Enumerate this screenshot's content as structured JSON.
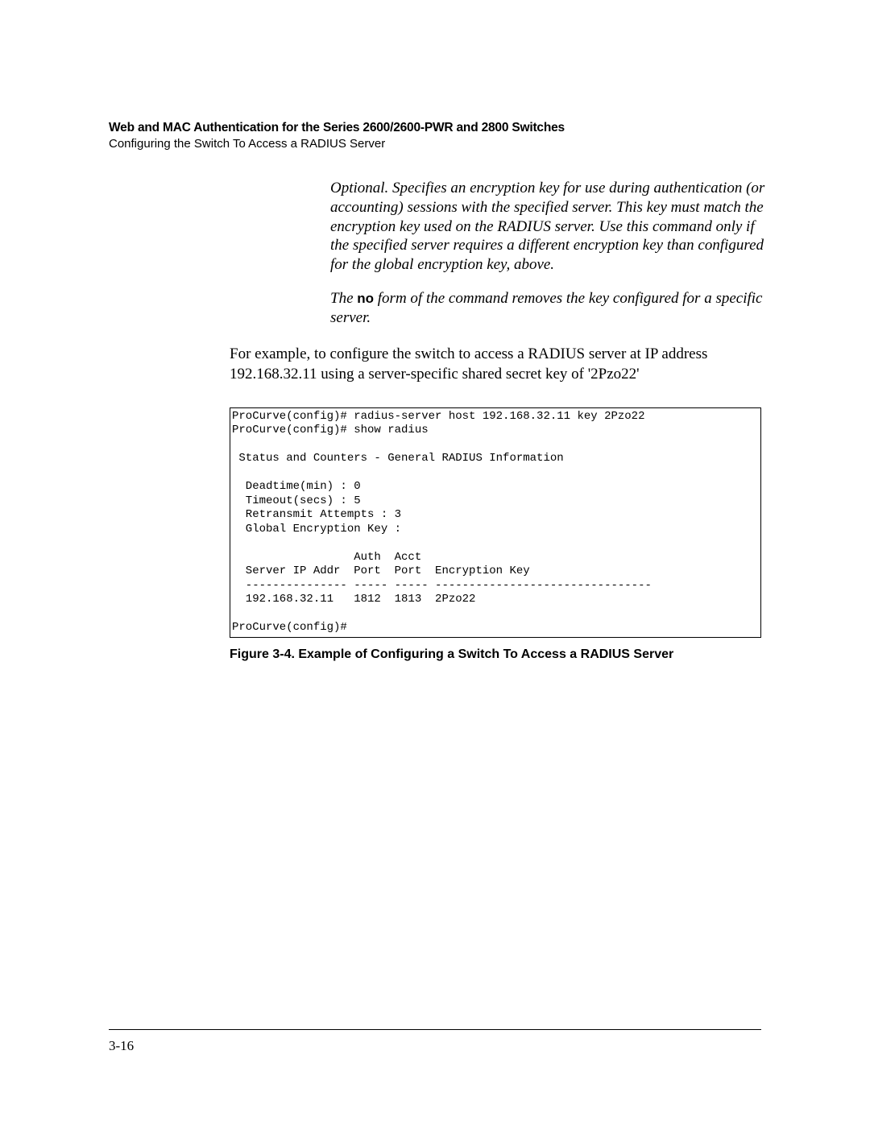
{
  "header": {
    "title": "Web and MAC Authentication for the Series 2600/2600-PWR and 2800 Switches",
    "subtitle": "Configuring the Switch To Access a RADIUS Server"
  },
  "description": {
    "para1": "Optional. Specifies an encryption key for use during authentication (or accounting) sessions with the specified server. This key must match the encryption key used on the RADIUS server. Use this command only if the specified server requires a different encryption key than configured for the global encryption key, above.",
    "para2_prefix": "The ",
    "para2_bold": "no",
    "para2_suffix": " form of the command removes the key configured for a specific server."
  },
  "example_intro": "For example, to configure the switch to access a RADIUS server at IP address 192.168.32.11 using a server-specific shared secret key of '2Pzo22'",
  "terminal": "ProCurve(config)# radius-server host 192.168.32.11 key 2Pzo22\nProCurve(config)# show radius\n\n Status and Counters - General RADIUS Information\n\n  Deadtime(min) : 0\n  Timeout(secs) : 5\n  Retransmit Attempts : 3\n  Global Encryption Key :\n\n                  Auth  Acct\n  Server IP Addr  Port  Port  Encryption Key\n  --------------- ----- ----- --------------------------------\n  192.168.32.11   1812  1813  2Pzo22\n\nProCurve(config)#",
  "figure_caption": "Figure 3-4. Example of Configuring a Switch To Access a RADIUS Server",
  "page_number": "3-16"
}
